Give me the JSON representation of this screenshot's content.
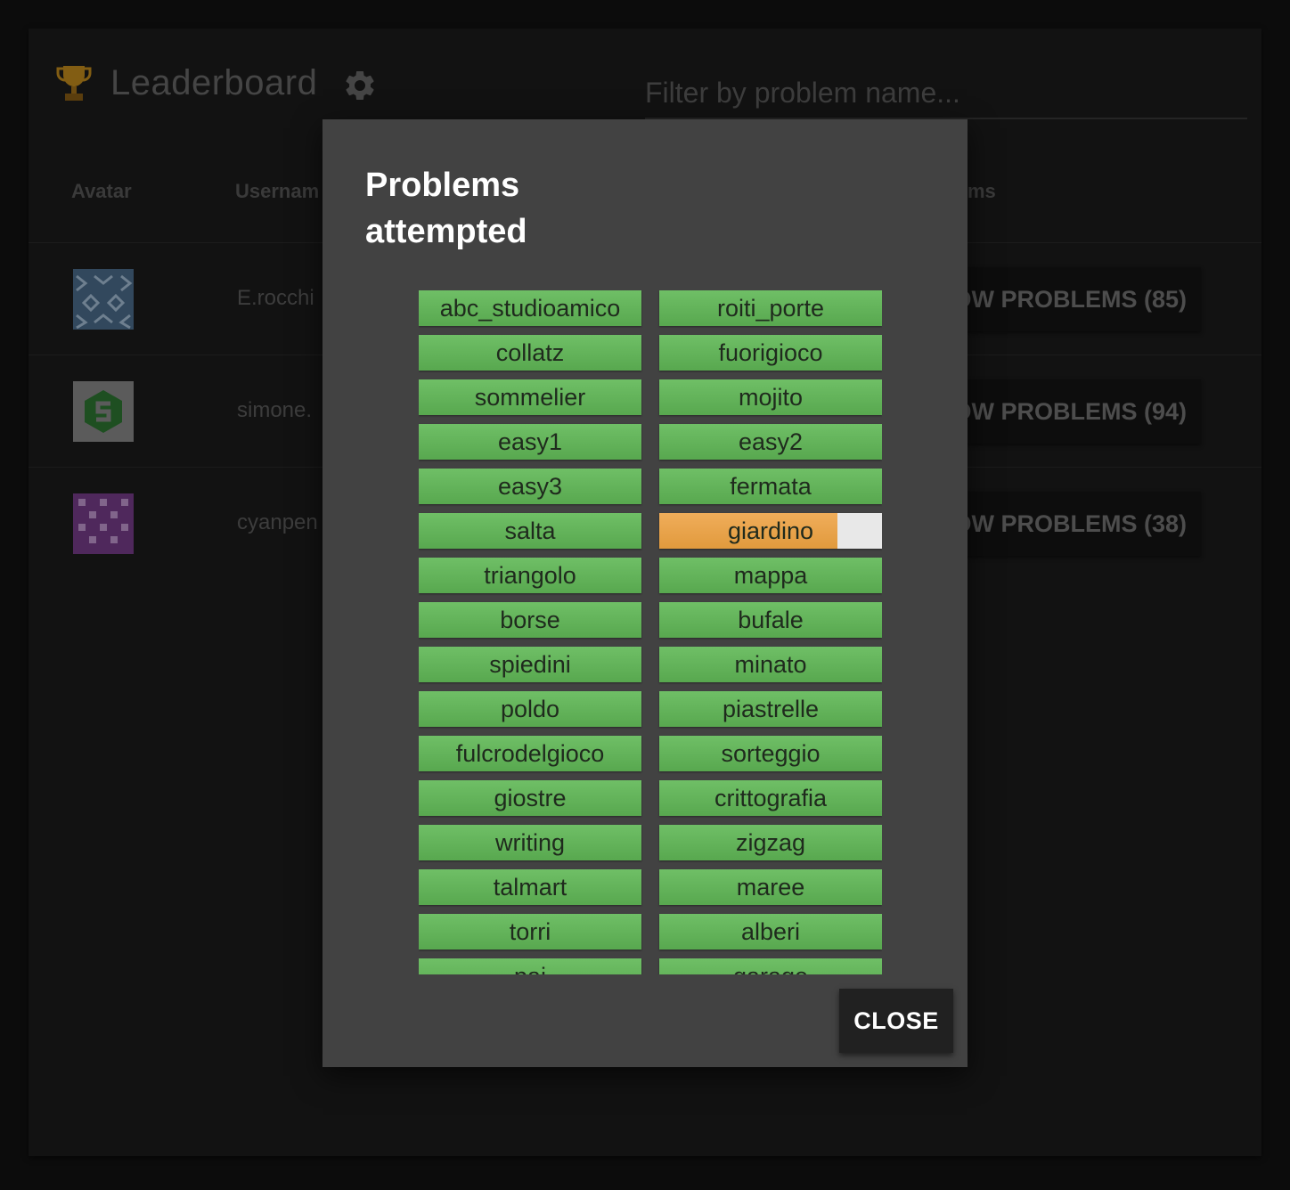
{
  "header": {
    "title": "Leaderboard",
    "filter_placeholder": "Filter by problem name..."
  },
  "table": {
    "columns": [
      "Avatar",
      "Usernam",
      "ms"
    ],
    "rows": [
      {
        "username": "E.rocchi",
        "button": "OW PROBLEMS (85)"
      },
      {
        "username": "simone.",
        "button": "OW PROBLEMS (94)"
      },
      {
        "username": "cyanpen",
        "button": "OW PROBLEMS (38)"
      }
    ]
  },
  "dialog": {
    "title": "Problems attempted",
    "close_label": "CLOSE",
    "problems": [
      {
        "name": "abc_studioamico",
        "score": 1.0
      },
      {
        "name": "roiti_porte",
        "score": 1.0
      },
      {
        "name": "collatz",
        "score": 1.0
      },
      {
        "name": "fuorigioco",
        "score": 1.0
      },
      {
        "name": "sommelier",
        "score": 1.0
      },
      {
        "name": "mojito",
        "score": 1.0
      },
      {
        "name": "easy1",
        "score": 1.0
      },
      {
        "name": "easy2",
        "score": 1.0
      },
      {
        "name": "easy3",
        "score": 1.0
      },
      {
        "name": "fermata",
        "score": 1.0
      },
      {
        "name": "salta",
        "score": 1.0
      },
      {
        "name": "giardino",
        "score": 0.8
      },
      {
        "name": "triangolo",
        "score": 1.0
      },
      {
        "name": "mappa",
        "score": 1.0
      },
      {
        "name": "borse",
        "score": 1.0
      },
      {
        "name": "bufale",
        "score": 1.0
      },
      {
        "name": "spiedini",
        "score": 1.0
      },
      {
        "name": "minato",
        "score": 1.0
      },
      {
        "name": "poldo",
        "score": 1.0
      },
      {
        "name": "piastrelle",
        "score": 1.0
      },
      {
        "name": "fulcrodelgioco",
        "score": 1.0
      },
      {
        "name": "sorteggio",
        "score": 1.0
      },
      {
        "name": "giostre",
        "score": 1.0
      },
      {
        "name": "crittografia",
        "score": 1.0
      },
      {
        "name": "writing",
        "score": 1.0
      },
      {
        "name": "zigzag",
        "score": 1.0
      },
      {
        "name": "talmart",
        "score": 1.0
      },
      {
        "name": "maree",
        "score": 1.0
      },
      {
        "name": "torri",
        "score": 1.0
      },
      {
        "name": "alberi",
        "score": 1.0
      },
      {
        "name": "pai",
        "score": 1.0
      },
      {
        "name": "garage",
        "score": 1.0
      }
    ]
  },
  "colors": {
    "full": "#5fb357",
    "partial": "#eba34b",
    "empty": "#e8e8e8"
  }
}
